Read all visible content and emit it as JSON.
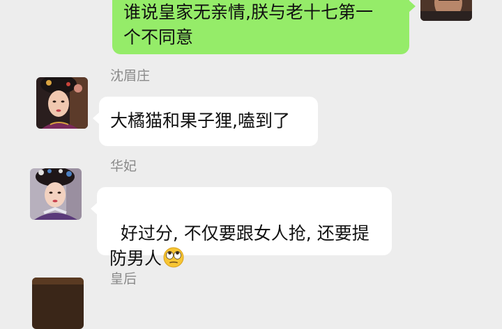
{
  "messages": [
    {
      "direction": "outgoing",
      "sender": "",
      "text": "谁说皇家无亲情,朕与老十七第一\n个不同意",
      "avatar_icon": "emperor-avatar"
    },
    {
      "direction": "incoming",
      "sender": "沈眉庄",
      "text": "大橘猫和果子狸,嗑到了",
      "avatar_icon": "shen-meizhuang-avatar"
    },
    {
      "direction": "incoming",
      "sender": "华妃",
      "text": "好过分, 不仅要跟女人抢, 还要提\n防男人",
      "emoji_icon": "eye-roll-emoji",
      "avatar_icon": "huafei-avatar"
    },
    {
      "direction": "incoming",
      "sender": "皇后",
      "text": "",
      "avatar_icon": "empress-avatar"
    }
  ],
  "colors": {
    "background": "#ededed",
    "incoming_bubble": "#ffffff",
    "outgoing_bubble": "#95ec69",
    "sender_name": "#8a8a8a"
  }
}
